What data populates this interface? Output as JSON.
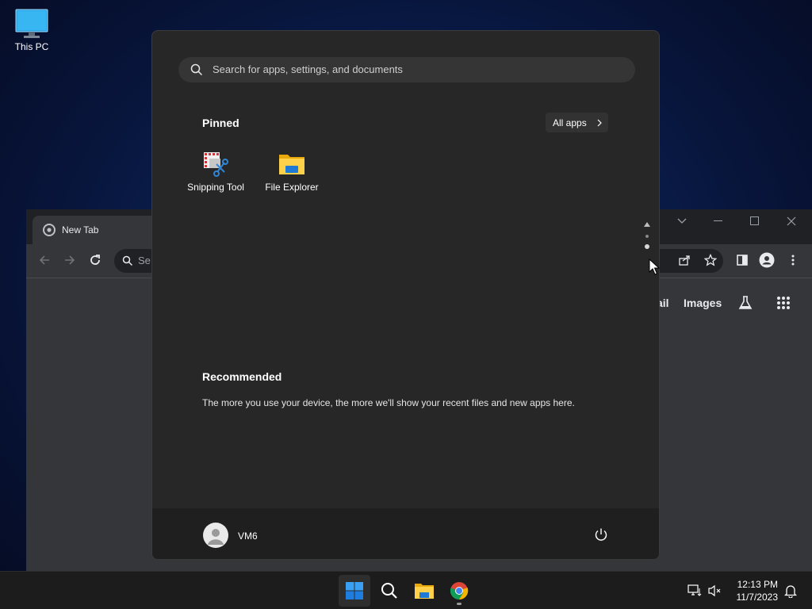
{
  "desktop": {
    "icons": [
      {
        "label": "This PC",
        "icon": "monitor-icon"
      }
    ]
  },
  "browser": {
    "tab_title": "New Tab",
    "omnibox_placeholder": "Se",
    "links": {
      "gmail": "ail",
      "images": "Images"
    }
  },
  "start_menu": {
    "search_placeholder": "Search for apps, settings, and documents",
    "pinned_heading": "Pinned",
    "all_apps_label": "All apps",
    "pinned_apps": [
      {
        "label": "Snipping Tool",
        "icon": "snipping-tool-icon"
      },
      {
        "label": "File Explorer",
        "icon": "folder-icon"
      }
    ],
    "recommended_heading": "Recommended",
    "recommended_text": "The more you use your device, the more we'll show your recent files and new apps here.",
    "user_name": "VM6"
  },
  "taskbar": {
    "time": "12:13 PM",
    "date": "11/7/2023"
  },
  "colors": {
    "start_bg": "#272727",
    "taskbar_bg": "#1c1c1c",
    "windows_blue": "#1e90ff"
  }
}
